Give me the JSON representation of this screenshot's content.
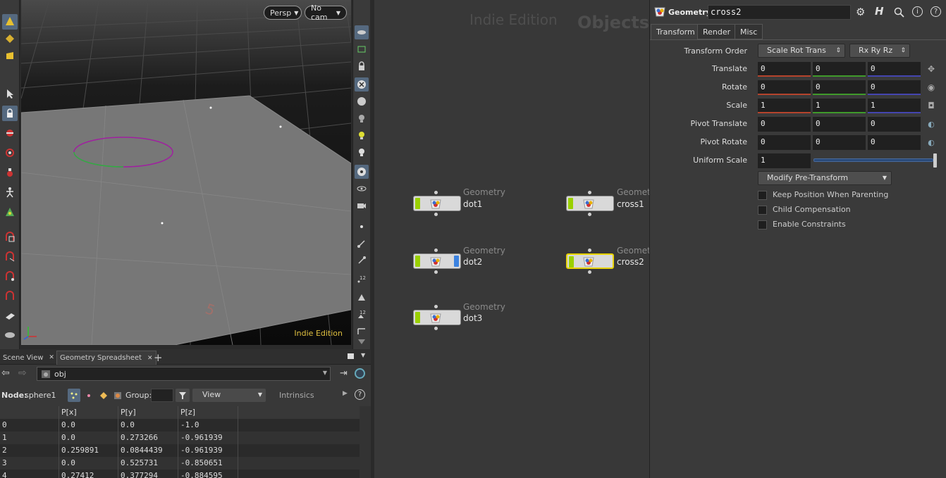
{
  "viewport": {
    "persp_label": "Persp",
    "cam_label": "No cam",
    "watermark": "Indie Edition",
    "grid_number": "5"
  },
  "pane_tabs": {
    "tab1": "Scene View",
    "tab2": "Geometry Spreadsheet",
    "add": "+"
  },
  "path": {
    "value": "obj"
  },
  "spreadsheet_toolbar": {
    "node_label": "Node:",
    "node_value": "sphere1",
    "group_label": "Group:",
    "view_label": "View",
    "intrinsics_label": "Intrinsics"
  },
  "spreadsheet": {
    "columns": [
      "",
      "P[x]",
      "P[y]",
      "P[z]"
    ],
    "rows": [
      [
        "0",
        "0.0",
        "0.0",
        "-1.0"
      ],
      [
        "1",
        "0.0",
        "0.273266",
        "-0.961939"
      ],
      [
        "2",
        "0.259891",
        "0.0844439",
        "-0.961939"
      ],
      [
        "3",
        "0.0",
        "0.525731",
        "-0.850651"
      ],
      [
        "4",
        "0.27412",
        "0.377294",
        "-0.884595"
      ]
    ]
  },
  "network": {
    "watermark": "Indie Edition",
    "context_label": "Objects",
    "nodes": [
      {
        "type": "Geometry",
        "name": "dot1"
      },
      {
        "type": "Geometry",
        "name": "cross1"
      },
      {
        "type": "Geometry",
        "name": "dot2"
      },
      {
        "type": "Geometry",
        "name": "cross2"
      },
      {
        "type": "Geometry",
        "name": "dot3"
      }
    ]
  },
  "params": {
    "type_label": "Geometry",
    "node_name": "cross2",
    "tabs": [
      "Transform",
      "Render",
      "Misc"
    ],
    "transform_order_label": "Transform Order",
    "transform_order_value": "Scale Rot Trans",
    "rotate_order_value": "Rx Ry Rz",
    "translate_label": "Translate",
    "translate": [
      "0",
      "0",
      "0"
    ],
    "rotate_label": "Rotate",
    "rotate": [
      "0",
      "0",
      "0"
    ],
    "scale_label": "Scale",
    "scale": [
      "1",
      "1",
      "1"
    ],
    "pivot_translate_label": "Pivot Translate",
    "pivot_translate": [
      "0",
      "0",
      "0"
    ],
    "pivot_rotate_label": "Pivot Rotate",
    "pivot_rotate": [
      "0",
      "0",
      "0"
    ],
    "uniform_scale_label": "Uniform Scale",
    "uniform_scale": "1",
    "modify_menu": "Modify Pre-Transform",
    "checkboxes": [
      "Keep Position When Parenting",
      "Child Compensation",
      "Enable Constraints"
    ]
  },
  "colors": {
    "node_flag_display": "#9ad000",
    "node_flag_render": "#3b82e0",
    "selected_node_outline": "#e8d300",
    "accent": "#55697f"
  }
}
